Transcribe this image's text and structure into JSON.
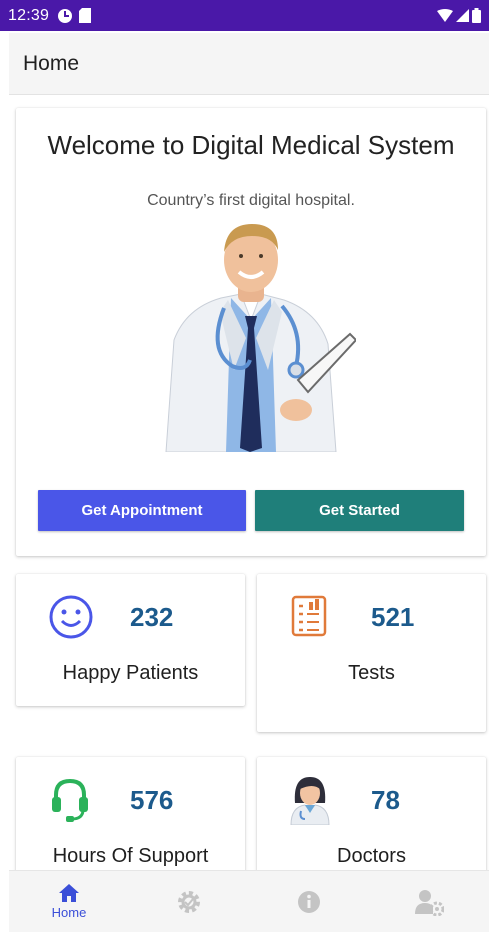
{
  "status_bar": {
    "time": "12:39"
  },
  "app_bar": {
    "title": "Home"
  },
  "hero": {
    "headline": "Welcome to Digital Medical System",
    "subline": "Country’s first digital hospital.",
    "buttons": {
      "appointment": "Get Appointment",
      "start": "Get Started"
    }
  },
  "stats": [
    {
      "icon": "smiley-face-icon",
      "value": "232",
      "label": "Happy Patients"
    },
    {
      "icon": "test-report-icon",
      "value": "521",
      "label": "Tests"
    },
    {
      "icon": "headset-icon",
      "value": "576",
      "label": "Hours Of Support"
    },
    {
      "icon": "female-doctor-icon",
      "value": "78",
      "label": "Doctors"
    }
  ],
  "bottom_nav": {
    "items": [
      {
        "icon": "home-icon",
        "label": "Home",
        "active": true
      },
      {
        "icon": "settings-gear-icon",
        "label": "",
        "active": false
      },
      {
        "icon": "info-icon",
        "label": "",
        "active": false
      },
      {
        "icon": "staff-gear-icon",
        "label": "",
        "active": false
      }
    ]
  },
  "colors": {
    "status_bar": "#4a18a8",
    "appointment_button": "#4a56e8",
    "start_button": "#1f7f7a",
    "stat_number": "#1c5a8c",
    "nav_active": "#3b4fd8",
    "nav_inactive": "#c4c4c4"
  }
}
